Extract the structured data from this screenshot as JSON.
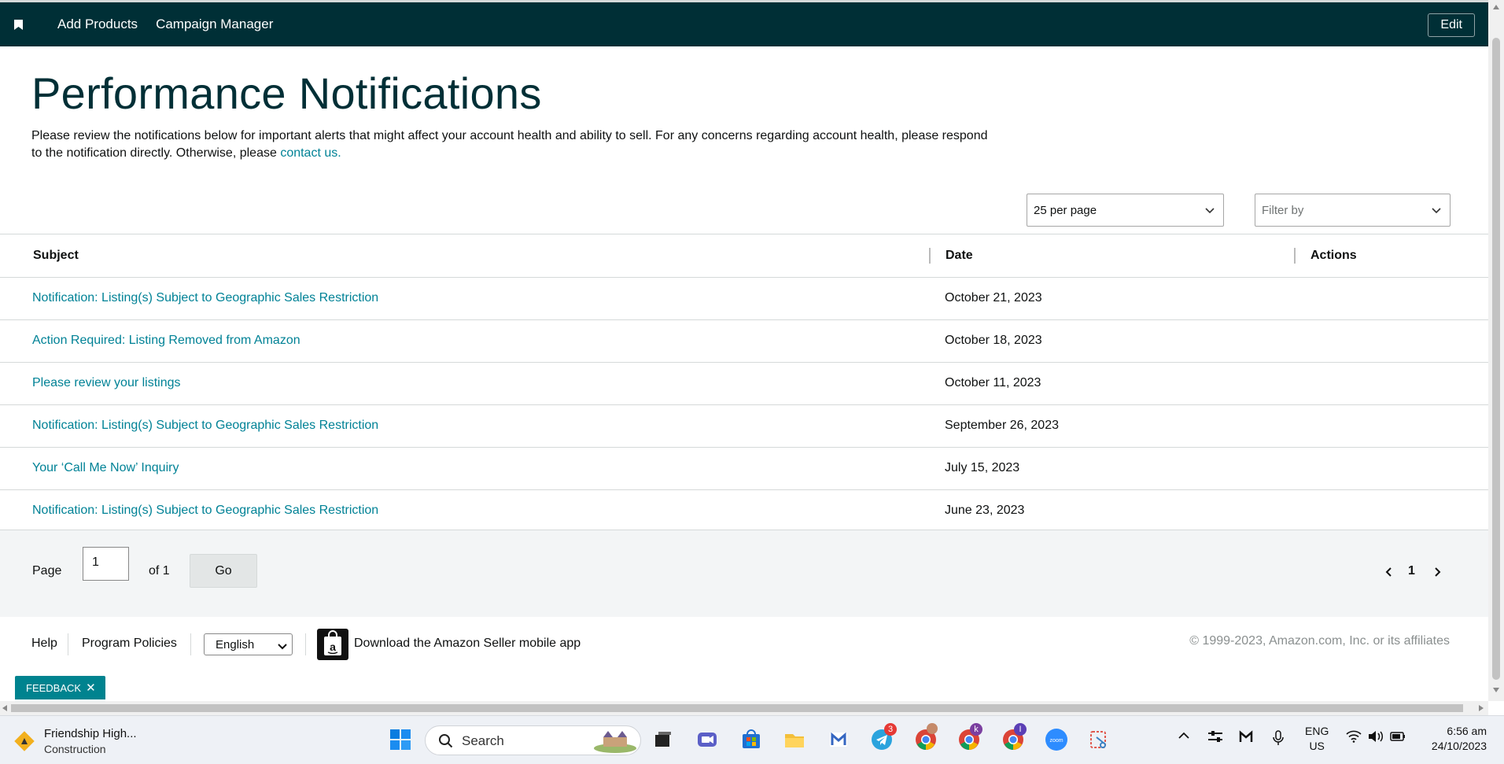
{
  "nav": {
    "items": [
      "Add Products",
      "Campaign Manager"
    ],
    "edit_label": "Edit"
  },
  "page": {
    "title": "Performance Notifications",
    "intro": "Please review the notifications below for important alerts that might affect your account health and ability to sell. For any concerns regarding account health, please respond to the notification directly. Otherwise, please ",
    "intro_link": "contact us."
  },
  "controls": {
    "per_page": "25 per page",
    "filter_placeholder": "Filter by"
  },
  "table": {
    "headers": {
      "subject": "Subject",
      "date": "Date",
      "actions": "Actions"
    },
    "rows": [
      {
        "subject": "Notification: Listing(s) Subject to Geographic Sales Restriction",
        "date": "October 21, 2023"
      },
      {
        "subject": "Action Required: Listing Removed from Amazon",
        "date": "October 18, 2023"
      },
      {
        "subject": "Please review your listings",
        "date": "October 11, 2023"
      },
      {
        "subject": "Notification: Listing(s) Subject to Geographic Sales Restriction",
        "date": "September 26, 2023"
      },
      {
        "subject": "Your ‘Call Me Now’ Inquiry",
        "date": "July 15, 2023"
      },
      {
        "subject": "Notification: Listing(s) Subject to Geographic Sales Restriction",
        "date": "June 23, 2023"
      }
    ]
  },
  "pager": {
    "page_label": "Page",
    "page_value": "1",
    "of_label": "of 1",
    "go_label": "Go",
    "current_page": "1"
  },
  "footer": {
    "help": "Help",
    "policies": "Program Policies",
    "language": "English",
    "app_text": "Download the Amazon Seller mobile app",
    "copyright": "© 1999-2023, Amazon.com, Inc. or its affiliates",
    "feedback": "FEEDBACK"
  },
  "taskbar": {
    "weather_title": "Friendship High...",
    "weather_sub": "Construction",
    "search_label": "Search",
    "telegram_badge": "3",
    "chrome_k_badge": "k",
    "chrome_i_badge": "I",
    "lang_line1": "ENG",
    "lang_line2": "US",
    "time": "6:56 am",
    "date": "24/10/2023"
  },
  "colors": {
    "nav_bg": "#002f36",
    "link": "#008296",
    "title": "#002f36",
    "feedback_bg": "#00838f"
  }
}
